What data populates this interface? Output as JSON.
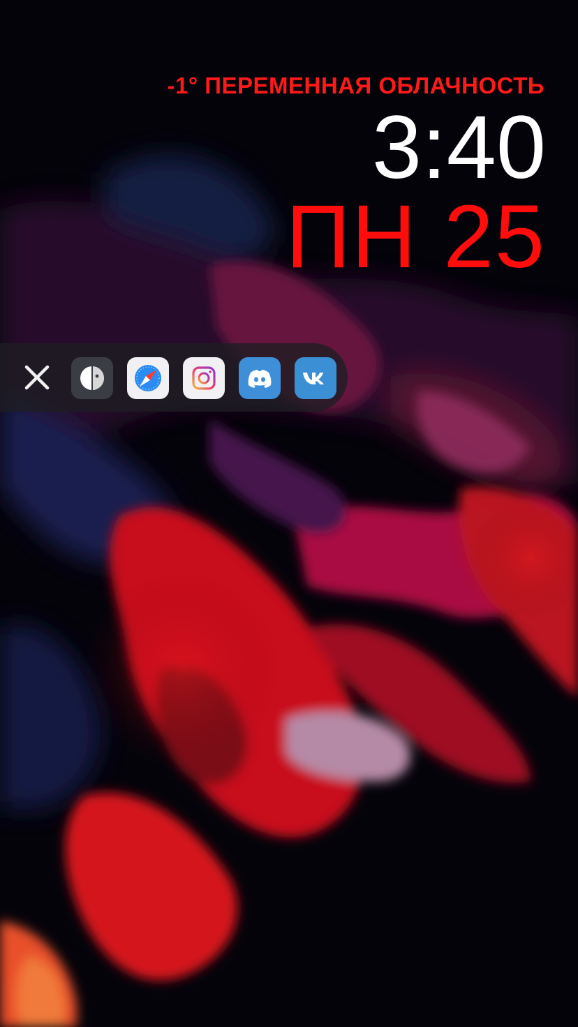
{
  "status": {
    "weather": "-1° ПЕРЕМЕННАЯ ОБЛАЧНОСТЬ",
    "time": "3:40",
    "date": "ПН 25"
  },
  "colors": {
    "accent_red": "#ff0d0d",
    "time_white": "#ffffff",
    "dock_background": "#1e1e22"
  },
  "dock": {
    "close_icon": "close-x-icon",
    "apps": [
      {
        "name": "circle-app",
        "icon": "half-circle-icon"
      },
      {
        "name": "safari",
        "icon": "compass-icon"
      },
      {
        "name": "instagram",
        "icon": "camera-icon"
      },
      {
        "name": "discord",
        "icon": "discord-icon"
      },
      {
        "name": "vk",
        "icon": "vk-icon"
      }
    ]
  }
}
